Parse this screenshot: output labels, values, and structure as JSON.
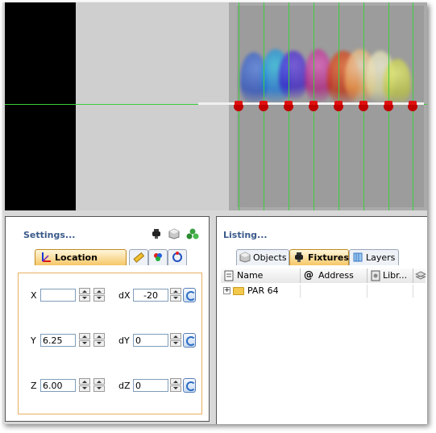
{
  "settings": {
    "title": "Settings...",
    "tabs": [
      {
        "label": "Location",
        "icon": "axes-icon",
        "active": true
      },
      {
        "label": "",
        "icon": "ruler-icon",
        "active": false
      },
      {
        "label": "",
        "icon": "color-wheel-icon",
        "active": false
      },
      {
        "label": "",
        "icon": "rotate-icon",
        "active": false
      }
    ],
    "header_icons": [
      "fixture-icon",
      "cube-icon",
      "group-icon"
    ],
    "fields": {
      "x": {
        "label": "X",
        "value": ""
      },
      "y": {
        "label": "Y",
        "value": "6.25"
      },
      "z": {
        "label": "Z",
        "value": "6.00"
      },
      "dx": {
        "label": "dX",
        "value": "-20"
      },
      "dy": {
        "label": "dY",
        "value": "0"
      },
      "dz": {
        "label": "dZ",
        "value": "0"
      }
    }
  },
  "listing": {
    "title": "Listing...",
    "tabs": [
      {
        "label": "Objects",
        "icon": "cube-icon",
        "active": false
      },
      {
        "label": "Fixtures",
        "icon": "fixture-icon",
        "active": true
      },
      {
        "label": "Layers",
        "icon": "layers-icon",
        "active": false
      }
    ],
    "columns": [
      {
        "label": "Name",
        "icon": "list-icon"
      },
      {
        "label": "Address",
        "icon": "at-icon"
      },
      {
        "label": "Libr...",
        "icon": "library-icon"
      }
    ],
    "rows": [
      {
        "expander": "+",
        "name": "PAR 64",
        "address": "",
        "library": ""
      }
    ]
  },
  "viewport": {
    "fixture_count": 8,
    "colors": {
      "grid": "#3ccf3c",
      "fixture": "#e01010",
      "beams": [
        "#3a6fd8",
        "#2bd0e0",
        "#4d38e8",
        "#d83aa0",
        "#e84a20",
        "#e8a020",
        "#f0e8c0",
        "#d8e060"
      ]
    }
  }
}
